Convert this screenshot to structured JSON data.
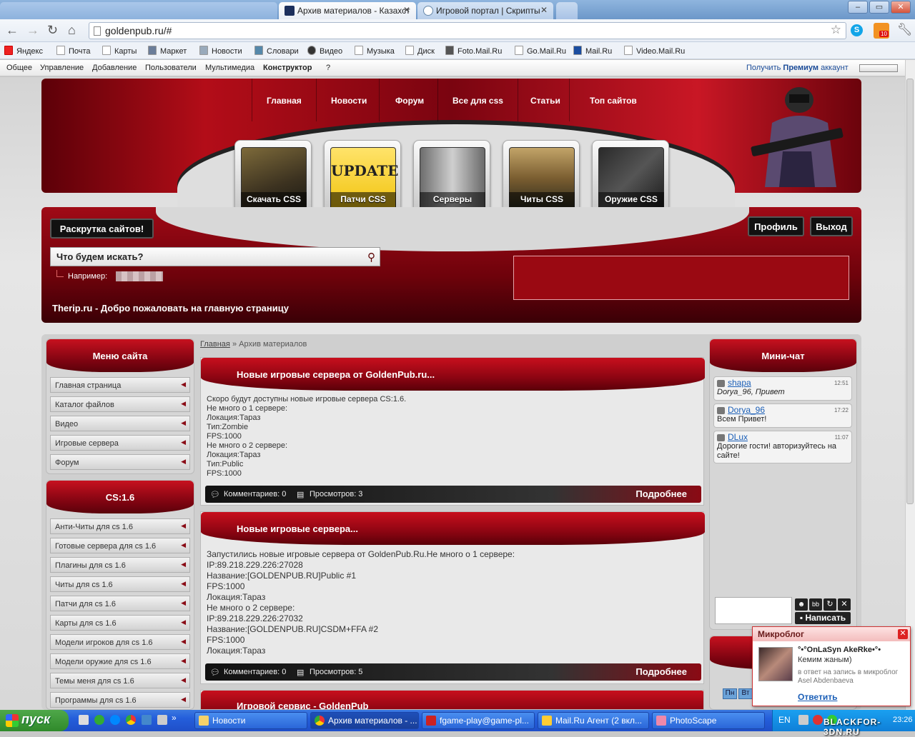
{
  "browser": {
    "tabs": [
      {
        "label": "Архив материалов - Казахст",
        "active": true
      },
      {
        "label": "Игровой портал | Скрипты",
        "active": false
      }
    ],
    "url": "goldenpub.ru/#",
    "window_buttons": [
      "–",
      "▭",
      "✕"
    ],
    "bookmarks": [
      "Яндекс",
      "Почта",
      "Карты",
      "Маркет",
      "Новости",
      "Словари",
      "Видео",
      "Музыка",
      "Диск",
      "Foto.Mail.Ru",
      "Go.Mail.Ru",
      "Mail.Ru",
      "Video.Mail.Ru"
    ],
    "rss_badge": "10"
  },
  "ucoz_bar": {
    "items": [
      "Общее",
      "Управление",
      "Добавление",
      "Пользователи",
      "Мультимедиа",
      "Конструктор",
      "?"
    ],
    "premium_prefix": "Получить",
    "premium_word": "Премиум",
    "premium_suffix": "аккаунт"
  },
  "site": {
    "top_nav": [
      "Главная",
      "Новости",
      "Форум",
      "Все для css",
      "Статьи",
      "Топ сайтов"
    ],
    "tiles": [
      "Скачать CSS",
      "Патчи CSS",
      "Серверы",
      "Читы CSS",
      "Оружие CSS"
    ],
    "tile_update_text": "UPDATE",
    "promo_button": "Раскрутка сайтов!",
    "profile_button": "Профиль",
    "logout_button": "Выход",
    "search_placeholder": "Что будем искать?",
    "search_example": "Например:",
    "welcome": "Therip.ru - Добро пожаловать на главную страницу"
  },
  "sidebar": {
    "menu_title": "Меню сайта",
    "menu_items": [
      "Главная страница",
      "Каталог файлов",
      "Видео",
      "Игровые сервера",
      "Форум"
    ],
    "cs_title": "CS:1.6",
    "cs_items": [
      "Анти-Читы для cs 1.6",
      "Готовые сервера для cs 1.6",
      "Плагины для cs 1.6",
      "Читы для cs 1.6",
      "Патчи для cs 1.6",
      "Карты для cs 1.6",
      "Модели игроков для cs 1.6",
      "Модели оружие для cs 1.6",
      "Темы меня для cs 1.6",
      "Программы для cs 1.6"
    ]
  },
  "breadcrumb": {
    "home": "Главная",
    "sep": "»",
    "current": "Архив материалов"
  },
  "posts": [
    {
      "title": "Новые игровые сервера от GoldenPub.ru...",
      "lines": [
        "Скоро будут доступны новые игровые сервера CS:1.6.",
        "Не много о 1 сервере:",
        "Локация:Тараз",
        "Тип:Zombie",
        "FPS:1000",
        "Не много о 2 сервере:",
        "Локация:Тараз",
        "Тип:Public",
        "FPS:1000"
      ],
      "comments": "Комментариев: 0",
      "views": "Просмотров: 3",
      "more": "Подробнее"
    },
    {
      "title": "Новые игровые сервера...",
      "lines": [
        "Запустились новые игровые сервера от GoldenPub.Ru.Не много о 1 сервере:",
        "IP:89.218.229.226:27028",
        "Название:[GOLDENPUB.RU]Public #1",
        "FPS:1000",
        "Локация:Тараз",
        "Не много о 2 сервере:",
        "IP:89.218.229.226:27032",
        "Название:[GOLDENPUB.RU]CSDM+FFA #2",
        "FPS:1000",
        "Локация:Тараз"
      ],
      "comments": "Комментариев: 0",
      "views": "Просмотров: 5",
      "more": "Подробнее"
    },
    {
      "title": "Игровой сервис - GoldenPub"
    }
  ],
  "minichat": {
    "title": "Мини-чат",
    "messages": [
      {
        "nick": "shapa",
        "time": "12:51",
        "text": "Dorya_96, Привет"
      },
      {
        "nick": "Dorya_96",
        "time": "17:22",
        "text": "Всем Привет!"
      },
      {
        "nick": "DLux",
        "time": "11:07",
        "text": "Дорогие гости! авторизуйтесь на сайте!"
      }
    ],
    "write_button": "Написать",
    "calendar_days": [
      "Пн",
      "Вт"
    ]
  },
  "microblog": {
    "title": "Микроблог",
    "user": "°•°OnLaSyn AkeRke•°•",
    "text": "Кемим жаным)",
    "context": "в ответ на запись в микроблог Asel Abdenbaeva",
    "reply": "Ответить"
  },
  "taskbar": {
    "start": "пуск",
    "tasks": [
      "Новости",
      "Архив материалов - ...",
      "fgame-play@game-pl...",
      "Mail.Ru Агент (2 вкл...",
      "PhotoScape"
    ],
    "lang": "EN",
    "clock": "23:26"
  },
  "watermark": "BLACKFOR-3DN.RU",
  "colors": {
    "brand_red": "#b30d18",
    "dark": "#111111",
    "link": "#1b5fb7"
  }
}
